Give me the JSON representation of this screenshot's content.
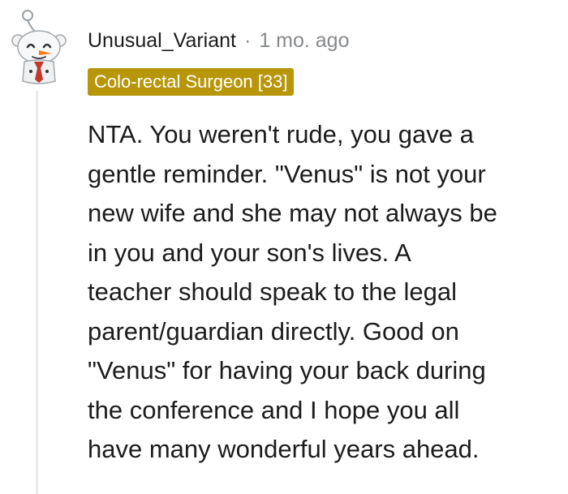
{
  "comment": {
    "username": "Unusual_Variant",
    "separator": "·",
    "age": "1 mo. ago",
    "flair": "Colo-rectal Surgeon [33]",
    "body_lines": [
      "NTA. You weren't rude, you gave a",
      "gentle reminder. \"Venus\" is not your",
      "new wife and she may not always be",
      "in you and your son's lives. A",
      "teacher should speak to the legal",
      "parent/guardian directly. Good on",
      "\"Venus\" for having your back during",
      "the conference and I hope you all",
      "have many wonderful years ahead."
    ]
  },
  "colors": {
    "flair_background": "#b8960a",
    "flair_text": "#ffffff",
    "meta_muted": "#878a8c",
    "thread_line": "#eaeaea",
    "text": "#1c1c1c"
  },
  "icons": {
    "avatar": "snoo-avatar-icon"
  }
}
